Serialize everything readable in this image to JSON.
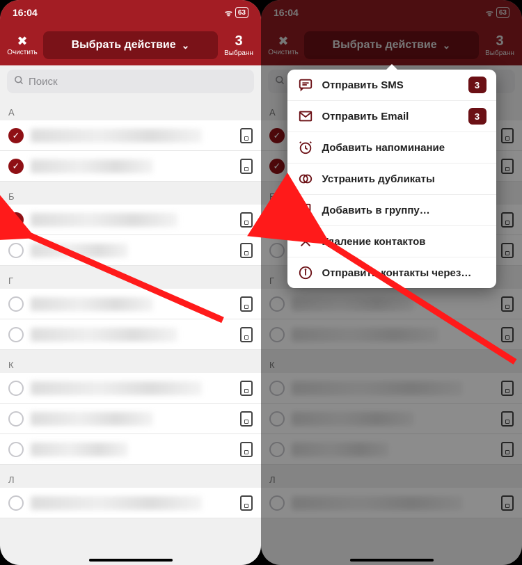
{
  "status": {
    "time": "16:04",
    "battery": "63"
  },
  "header": {
    "clear_label": "Очистить",
    "action_label": "Выбрать действие",
    "selected_count": "3",
    "selected_label": "Выбранн"
  },
  "search": {
    "placeholder": "Поиск"
  },
  "sections": [
    {
      "letter": "А",
      "rows": [
        {
          "checked": true,
          "w": "w70"
        },
        {
          "checked": true,
          "w": "w50"
        }
      ]
    },
    {
      "letter": "Б",
      "rows": [
        {
          "checked": true,
          "w": "w60"
        },
        {
          "checked": false,
          "w": "w40"
        }
      ]
    },
    {
      "letter": "Г",
      "rows": [
        {
          "checked": false,
          "w": "w50"
        },
        {
          "checked": false,
          "w": "w60"
        }
      ]
    },
    {
      "letter": "К",
      "rows": [
        {
          "checked": false,
          "w": "w70"
        },
        {
          "checked": false,
          "w": "w50"
        },
        {
          "checked": false,
          "w": "w40"
        }
      ]
    },
    {
      "letter": "Л",
      "rows": [
        {
          "checked": false,
          "w": "w70"
        }
      ]
    }
  ],
  "popup": {
    "items": [
      {
        "icon": "sms",
        "label": "Отправить SMS",
        "badge": "3"
      },
      {
        "icon": "email",
        "label": "Отправить Email",
        "badge": "3"
      },
      {
        "icon": "reminder",
        "label": "Добавить напоминание",
        "badge": null
      },
      {
        "icon": "dup",
        "label": "Устранить дубликаты",
        "badge": null
      },
      {
        "icon": "group",
        "label": "Добавить в группу…",
        "badge": null
      },
      {
        "icon": "delete",
        "label": "Удаление контактов",
        "badge": null
      },
      {
        "icon": "share",
        "label": "Отправить контакты через…",
        "badge": null
      }
    ]
  }
}
